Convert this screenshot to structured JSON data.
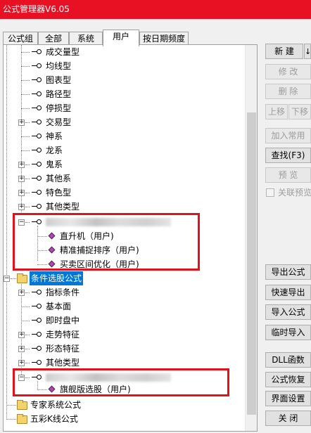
{
  "window": {
    "title": "公式管理器V6.05"
  },
  "tabs": [
    {
      "label": "公式组"
    },
    {
      "label": "全部"
    },
    {
      "label": "系统"
    },
    {
      "label": "用户"
    },
    {
      "label": "按日期频度"
    }
  ],
  "tree": {
    "items": [
      {
        "label": "成交量型"
      },
      {
        "label": "均线型"
      },
      {
        "label": "图表型"
      },
      {
        "label": "路径型"
      },
      {
        "label": "停损型"
      },
      {
        "label": "交易型"
      },
      {
        "label": "神系"
      },
      {
        "label": "龙系"
      },
      {
        "label": "鬼系"
      },
      {
        "label": "其他系"
      },
      {
        "label": "特色型"
      },
      {
        "label": "其他类型"
      },
      {
        "label": ""
      },
      {
        "label": "直升机（用户)"
      },
      {
        "label": "精准捕捉排序（用户)"
      },
      {
        "label": "买卖区间优化（用户)"
      },
      {
        "label": "条件选股公式"
      },
      {
        "label": "指标条件"
      },
      {
        "label": "基本面"
      },
      {
        "label": "即时盘中"
      },
      {
        "label": "走势特征"
      },
      {
        "label": "形态特征"
      },
      {
        "label": "其他类型"
      },
      {
        "label": ""
      },
      {
        "label": "旗舰版选股（用户)"
      },
      {
        "label": "专家系统公式"
      },
      {
        "label": "五彩K线公式"
      }
    ]
  },
  "buttons": {
    "new": "新 建",
    "edit": "修 改",
    "delete": "删 除",
    "move_up": "上移",
    "move_down": "下移",
    "add_common": "加入常用",
    "find": "查找(F3)",
    "preview": "预 览",
    "link_preview": "关联预览",
    "export": "导出公式",
    "quick_export": "快速导出",
    "import": "导入公式",
    "temp_import": "临时导入",
    "dll": "DLL函数",
    "restore": "公式恢复",
    "ui_settings": "界面设置",
    "close": "关 闭"
  },
  "colors": {
    "titlebar": "#e81123",
    "selection": "#0078d7",
    "annotation_box": "#e0131a",
    "formula_icon": "#b04ab0"
  }
}
